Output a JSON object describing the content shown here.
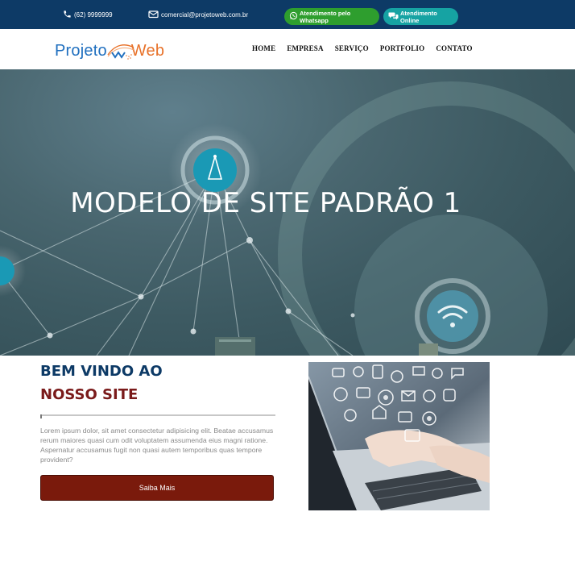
{
  "topbar": {
    "phone": "(62) 9999999",
    "email": "comercial@projetoweb.com.br",
    "whatsapp_label": "Atendimento pelo Whatsapp",
    "online_label": "Atendimento Online",
    "colors": {
      "bar": "#0d3a66",
      "whatsapp": "#2e9e2e",
      "online": "#16a3a3"
    }
  },
  "logo": {
    "part1": "Projeto",
    "part2": "Web"
  },
  "nav": {
    "items": [
      "HOME",
      "EMPRESA",
      "SERVIÇO",
      "PORTFOLIO",
      "CONTATO"
    ]
  },
  "hero": {
    "title": "MODELO DE SITE PADRÃO 1"
  },
  "welcome": {
    "line1": "BEM VINDO AO",
    "line2": "NOSSO SITE",
    "text": "Lorem ipsum dolor, sit amet consectetur adipisicing elit. Beatae accusamus rerum maiores quasi cum odit voluptatem assumenda eius magni ratione. Aspernatur accusamus fugit non quasi autem temporibus quas tempore provident?",
    "button": "Saiba Mais"
  },
  "colors": {
    "primary": "#0d3a66",
    "accent": "#7a1a1a"
  }
}
